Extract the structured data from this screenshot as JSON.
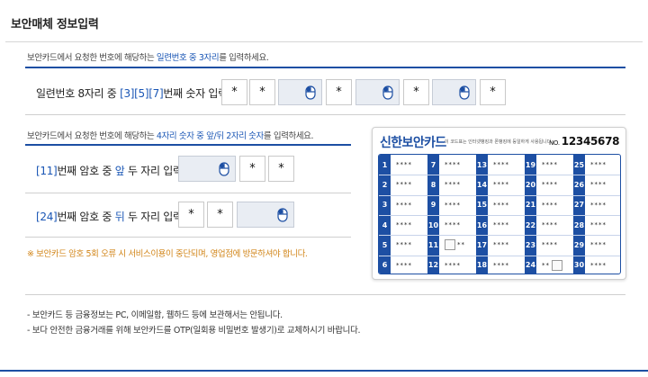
{
  "page_title": "보안매체 정보입력",
  "section1": {
    "instruction": {
      "pre": "보안카드에서 요청한 번호에 해당하는 ",
      "highlight": "일련번호 중 3자리",
      "post": "를 입력하세요."
    },
    "label": {
      "pre": "일련번호 8자리 중 ",
      "highlight": "[3][5][7]",
      "post": "번째 숫자 입력"
    },
    "boxes": [
      "*",
      "*",
      "mouse",
      "*",
      "mouse",
      "*",
      "mouse",
      "*"
    ]
  },
  "section2": {
    "instruction": {
      "pre": "보안카드에서 요청한 번호에 해당하는 ",
      "highlight": "4자리 숫자 중 앞/뒤 2자리 숫자",
      "post": "를 입력하세요."
    },
    "row1": {
      "label_num": "[11]",
      "label_pre": "번째 암호 중 ",
      "label_hl": "앞",
      "label_post": " 두 자리 입력",
      "boxes": [
        "mouse",
        "*",
        "*"
      ]
    },
    "row2": {
      "label_num": "[24]",
      "label_pre": "번째 암호 중 ",
      "label_hl": "뒤",
      "label_post": " 두 자리 입력",
      "boxes": [
        "*",
        "*",
        "mouse"
      ]
    },
    "warning": "※ 보안카드 암호 5회 오류 시 서비스이용이 중단되며, 영업점에 방문하셔야 합니다."
  },
  "card": {
    "brand": "신한보안카드",
    "note": "이 코드표는 인터넷뱅킹과 폰뱅킹에 등일하게 사용됩니다.",
    "number_label": "NO.",
    "number": "12345678",
    "cells": [
      {
        "n": "1",
        "v": "****"
      },
      {
        "n": "7",
        "v": "****"
      },
      {
        "n": "13",
        "v": "****"
      },
      {
        "n": "19",
        "v": "****"
      },
      {
        "n": "25",
        "v": "****"
      },
      {
        "n": "2",
        "v": "****"
      },
      {
        "n": "8",
        "v": "****"
      },
      {
        "n": "14",
        "v": "****"
      },
      {
        "n": "20",
        "v": "****"
      },
      {
        "n": "26",
        "v": "****"
      },
      {
        "n": "3",
        "v": "****"
      },
      {
        "n": "9",
        "v": "****"
      },
      {
        "n": "15",
        "v": "****"
      },
      {
        "n": "21",
        "v": "****"
      },
      {
        "n": "27",
        "v": "****"
      },
      {
        "n": "4",
        "v": "****"
      },
      {
        "n": "10",
        "v": "****"
      },
      {
        "n": "16",
        "v": "****"
      },
      {
        "n": "22",
        "v": "****"
      },
      {
        "n": "28",
        "v": "****"
      },
      {
        "n": "5",
        "v": "****"
      },
      {
        "n": "11",
        "v": "**",
        "box": "before"
      },
      {
        "n": "17",
        "v": "****"
      },
      {
        "n": "23",
        "v": "****"
      },
      {
        "n": "29",
        "v": "****"
      },
      {
        "n": "6",
        "v": "****"
      },
      {
        "n": "12",
        "v": "****"
      },
      {
        "n": "18",
        "v": "****"
      },
      {
        "n": "24",
        "v": "**",
        "box": "after"
      },
      {
        "n": "30",
        "v": "****"
      }
    ]
  },
  "notes": [
    "-  보안카드 등 금융정보는 PC, 이메일함, 웹하드 등에 보관해서는 안됩니다.",
    "-  보다 안전한 금융거래를 위해 보안카드를 OTP(일회용 비밀번호 발생기)로 교체하시기 바랍니다."
  ],
  "colors": {
    "accent": "#1d4fa3",
    "warning": "#d2861a",
    "input_gray": "#e9edf3"
  }
}
